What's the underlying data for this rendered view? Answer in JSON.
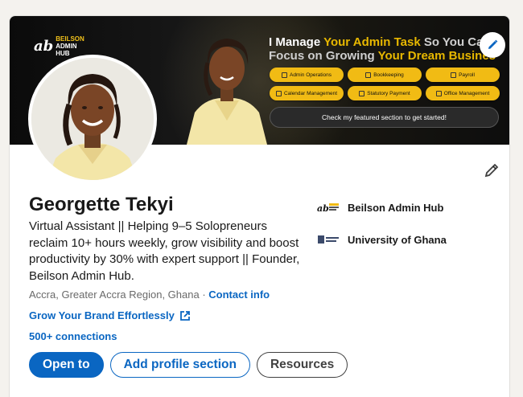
{
  "banner": {
    "brand_mark": "ab",
    "brand_word1": "BEILSON",
    "brand_word2": "ADMIN",
    "brand_word3": "HUB",
    "tagline_line1_a": "I Manage ",
    "tagline_line1_b": "Your Admin Task",
    "tagline_line1_c": " So You Ca",
    "tagline_line2_a": "Focus on ",
    "tagline_line2_b": "Growing ",
    "tagline_line2_c": "Your Dream Busines",
    "pills": [
      "Admin Operations",
      "Bookkeeping",
      "Payroll",
      "Calendar Management",
      "Statutory Payment",
      "Office Management"
    ],
    "cta": "Check my featured section to get started!"
  },
  "profile": {
    "name": "Georgette Tekyi",
    "headline": "Virtual Assistant || Helping 9–5 Solopreneurs reclaim 10+ hours weekly, grow visibility and boost productivity by 30% with expert support || Founder, Beilson Admin Hub.",
    "location": "Accra, Greater Accra Region, Ghana",
    "separator": " · ",
    "contact_info": "Contact info",
    "website": "Grow Your Brand Effortlessly",
    "connections": "500+ connections"
  },
  "experience": [
    {
      "label": "Beilson Admin Hub",
      "icon": "beilson-logo"
    },
    {
      "label": "University of Ghana",
      "icon": "university-of-ghana-logo"
    }
  ],
  "actions": {
    "open_to": "Open to",
    "add_section": "Add profile section",
    "resources": "Resources"
  },
  "colors": {
    "accent": "#0a66c2",
    "gold": "#f1bb14"
  }
}
